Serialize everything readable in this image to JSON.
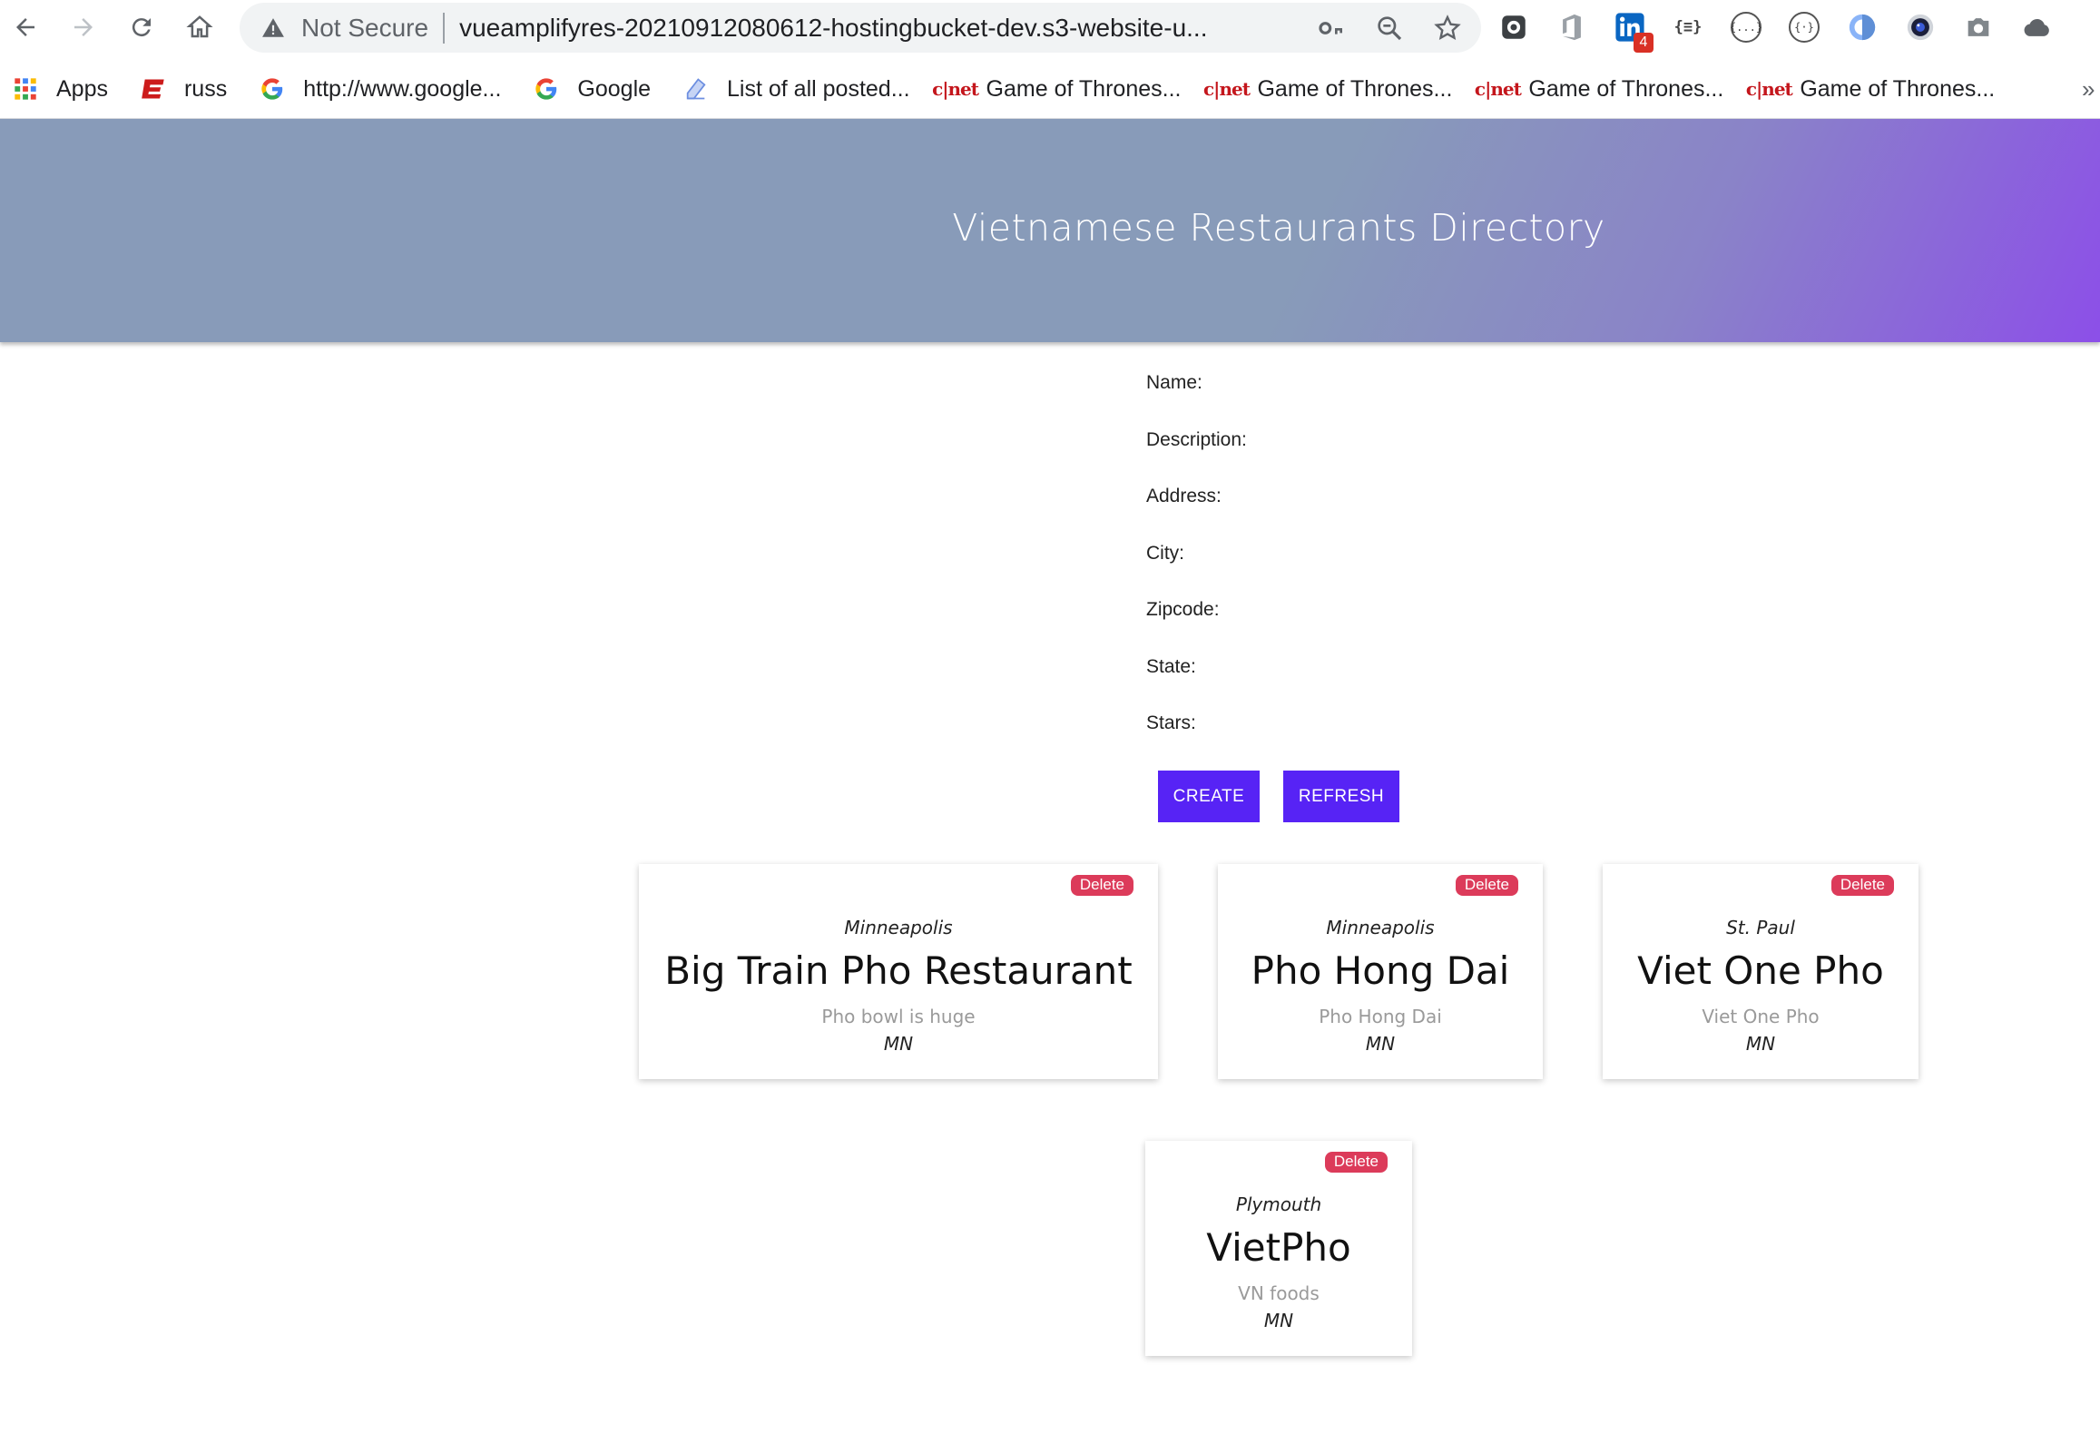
{
  "browser": {
    "omnibox": {
      "security_label": "Not Secure",
      "url": "vueamplifyres-20210912080612-hostingbucket-dev.s3-website-u..."
    },
    "extensions": [
      {
        "name": "extension-1"
      },
      {
        "name": "office"
      },
      {
        "name": "linkedin",
        "badge": "4"
      },
      {
        "name": "json-formatter",
        "label": "{≡}"
      },
      {
        "name": "extension-braces-1",
        "label": "{...}"
      },
      {
        "name": "extension-braces-2",
        "label": "{·}"
      }
    ],
    "bookmarks": [
      {
        "icon": "apps-grid-icon",
        "label": "Apps"
      },
      {
        "icon": "espn-icon",
        "label": "russ"
      },
      {
        "icon": "google-icon",
        "label": "http://www.google..."
      },
      {
        "icon": "google-icon",
        "label": "Google"
      },
      {
        "icon": "doc-icon",
        "label": "List of all posted..."
      },
      {
        "icon": "cnet-icon",
        "label": "Game of Thrones..."
      },
      {
        "icon": "cnet-icon",
        "label": "Game of Thrones..."
      },
      {
        "icon": "cnet-icon",
        "label": "Game of Thrones..."
      },
      {
        "icon": "cnet-icon",
        "label": "Game of Thrones..."
      }
    ],
    "cnet_text": "c|net",
    "more_label": "»"
  },
  "page": {
    "title": "Vietnamese Restaurants Directory",
    "form": {
      "name_label": "Name:",
      "description_label": "Description:",
      "address_label": "Address:",
      "city_label": "City:",
      "zipcode_label": "Zipcode:",
      "state_label": "State:",
      "stars_label": "Stars:"
    },
    "buttons": {
      "create": "CREATE",
      "refresh": "REFRESH"
    },
    "delete_label": "Delete",
    "restaurants": [
      {
        "city": "Minneapolis",
        "name": "Big Train Pho Restaurant",
        "description": "Pho bowl is huge",
        "state": "MN"
      },
      {
        "city": "Minneapolis",
        "name": "Pho Hong Dai",
        "description": "Pho Hong Dai",
        "state": "MN"
      },
      {
        "city": "St. Paul",
        "name": "Viet One Pho",
        "description": "Viet One Pho",
        "state": "MN"
      },
      {
        "city": "Plymouth",
        "name": "VietPho",
        "description": "VN foods",
        "state": "MN"
      }
    ]
  },
  "colors": {
    "accent_button": "#5723f5",
    "delete_badge": "#dc3b5a",
    "header_gradient_start": "#889bb9",
    "header_gradient_end": "#8c4fe8"
  }
}
